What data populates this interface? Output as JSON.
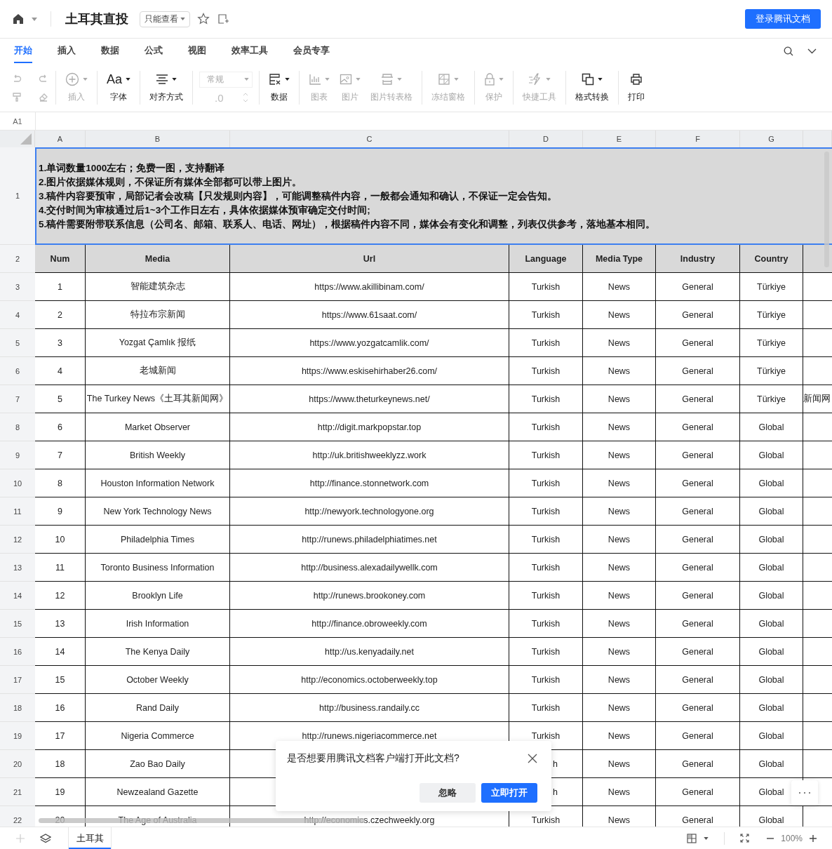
{
  "topbar": {
    "title": "土耳其直投",
    "permission": "只能查看",
    "login_button": "登录腾讯文档"
  },
  "menu_tabs": [
    {
      "label": "开始",
      "selected": true
    },
    {
      "label": "插入",
      "selected": false
    },
    {
      "label": "数据",
      "selected": false
    },
    {
      "label": "公式",
      "selected": false
    },
    {
      "label": "视图",
      "selected": false
    },
    {
      "label": "效率工具",
      "selected": false
    },
    {
      "label": "会员专享",
      "selected": false
    }
  ],
  "history_tools": [
    {
      "kind": "undo",
      "disabled": true
    },
    {
      "kind": "redo",
      "disabled": true
    },
    {
      "kind": "paint",
      "disabled": true
    },
    {
      "kind": "eraser",
      "disabled": true
    }
  ],
  "toolbar_groups": [
    {
      "items": [
        {
          "kind": "insert",
          "label": "插入",
          "disabled": true,
          "dropdown": true
        }
      ]
    },
    {
      "items": [
        {
          "kind": "font",
          "glyph": "Aa",
          "label": "字体",
          "disabled": false,
          "dropdown": true
        }
      ]
    },
    {
      "items": [
        {
          "kind": "align",
          "label": "对齐方式",
          "disabled": false,
          "dropdown": true
        }
      ]
    },
    {
      "kind": "number-format",
      "format": "常规",
      "decimal": ".0",
      "disabled": true
    },
    {
      "items": [
        {
          "kind": "data",
          "label": "数据",
          "disabled": false,
          "dropdown": true
        }
      ]
    },
    {
      "items": [
        {
          "kind": "chart",
          "label": "图表",
          "disabled": true,
          "dropdown": true
        },
        {
          "kind": "image",
          "label": "图片",
          "disabled": true,
          "dropdown": true
        },
        {
          "kind": "image-table",
          "label": "图片转表格",
          "disabled": true,
          "dropdown": true
        }
      ]
    },
    {
      "items": [
        {
          "kind": "freeze",
          "label": "冻结窗格",
          "disabled": true,
          "dropdown": true
        }
      ]
    },
    {
      "items": [
        {
          "kind": "protect",
          "label": "保护",
          "disabled": true,
          "dropdown": true
        }
      ]
    },
    {
      "items": [
        {
          "kind": "quick",
          "label": "快捷工具",
          "disabled": true,
          "dropdown": true
        }
      ]
    },
    {
      "items": [
        {
          "kind": "convert",
          "label": "格式转换",
          "disabled": false,
          "dropdown": true
        }
      ]
    },
    {
      "items": [
        {
          "kind": "print",
          "label": "打印",
          "disabled": false,
          "dropdown": false
        }
      ]
    }
  ],
  "cell_reference": "A1",
  "columns": [
    "A",
    "B",
    "C",
    "D",
    "E",
    "F",
    "G"
  ],
  "notice": {
    "row": "1",
    "lines": [
      "1.单词数量1000左右；免费一图，支持翻译",
      "2.图片依据媒体规则，不保证所有媒体全部都可以带上图片。",
      "3.稿件内容要预审，局部记者会改稿【只发规则内容】，可能调整稿件内容，一般都会通知和确认，不保证一定会告知。",
      "4.交付时间为审核通过后1~3个工作日左右，具体依据媒体预审确定交付时间;",
      "5.稿件需要附带联系信息（公司名、邮箱、联系人、电话、网址），根据稿件内容不同，媒体会有变化和调整，列表仅供参考，落地基本相同。"
    ]
  },
  "header": {
    "row": "2",
    "cells": [
      "Num",
      "Media",
      "Url",
      "Language",
      "Media Type",
      "Industry",
      "Country"
    ]
  },
  "rows": [
    {
      "row": "3",
      "num": "1",
      "media": "智能建筑杂志",
      "url": "https://www.akillibinam.com/",
      "language": "Turkish",
      "media_type": "News",
      "industry": "General",
      "country": "Türkiye"
    },
    {
      "row": "4",
      "num": "2",
      "media": "特拉布宗新闻",
      "url": "https://www.61saat.com/",
      "language": "Turkish",
      "media_type": "News",
      "industry": "General",
      "country": "Türkiye"
    },
    {
      "row": "5",
      "num": "3",
      "media": "Yozgat Çamlık 报纸",
      "url": "https://www.yozgatcamlik.com/",
      "language": "Turkish",
      "media_type": "News",
      "industry": "General",
      "country": "Türkiye"
    },
    {
      "row": "6",
      "num": "4",
      "media": "老城新闻",
      "url": "https://www.eskisehirhaber26.com/",
      "language": "Turkish",
      "media_type": "News",
      "industry": "General",
      "country": "Türkiye"
    },
    {
      "row": "7",
      "num": "5",
      "media": "The Turkey News《土耳其新闻网》",
      "url": "https://www.theturkeynews.net/",
      "language": "Turkish",
      "media_type": "News",
      "industry": "General",
      "country": "Türkiye",
      "column_8": "新闻网"
    },
    {
      "row": "8",
      "num": "6",
      "media": "Market Observer",
      "url": "http://digit.markpopstar.top",
      "language": "Turkish",
      "media_type": "News",
      "industry": "General",
      "country": "Global"
    },
    {
      "row": "9",
      "num": "7",
      "media": "British Weekly",
      "url": "http://uk.britishweeklyzz.work",
      "language": "Turkish",
      "media_type": "News",
      "industry": "General",
      "country": "Global"
    },
    {
      "row": "10",
      "num": "8",
      "media": "Houston Information Network",
      "url": "http://finance.stonnetwork.com",
      "language": "Turkish",
      "media_type": "News",
      "industry": "General",
      "country": "Global"
    },
    {
      "row": "11",
      "num": "9",
      "media": "New York Technology News",
      "url": "http://newyork.technologyone.org",
      "language": "Turkish",
      "media_type": "News",
      "industry": "General",
      "country": "Global"
    },
    {
      "row": "12",
      "num": "10",
      "media": "Philadelphia Times",
      "url": "http://runews.philadelphiatimes.net",
      "language": "Turkish",
      "media_type": "News",
      "industry": "General",
      "country": "Global"
    },
    {
      "row": "13",
      "num": "11",
      "media": "Toronto Business Information",
      "url": "http://business.alexadailywellk.com",
      "language": "Turkish",
      "media_type": "News",
      "industry": "General",
      "country": "Global"
    },
    {
      "row": "14",
      "num": "12",
      "media": "Brooklyn Life",
      "url": "http://runews.brookoney.com",
      "language": "Turkish",
      "media_type": "News",
      "industry": "General",
      "country": "Global"
    },
    {
      "row": "15",
      "num": "13",
      "media": "Irish Information",
      "url": "http://finance.obroweekly.com",
      "language": "Turkish",
      "media_type": "News",
      "industry": "General",
      "country": "Global"
    },
    {
      "row": "16",
      "num": "14",
      "media": "The Kenya Daily",
      "url": "http://us.kenyadaily.net",
      "language": "Turkish",
      "media_type": "News",
      "industry": "General",
      "country": "Global"
    },
    {
      "row": "17",
      "num": "15",
      "media": "October Weekly",
      "url": "http://economics.octoberweekly.top",
      "language": "Turkish",
      "media_type": "News",
      "industry": "General",
      "country": "Global"
    },
    {
      "row": "18",
      "num": "16",
      "media": "Rand Daily",
      "url": "http://business.randaily.cc",
      "language": "Turkish",
      "media_type": "News",
      "industry": "General",
      "country": "Global"
    },
    {
      "row": "19",
      "num": "17",
      "media": "Nigeria Commerce",
      "url": "http://runews.nigeriacommerce.net",
      "language": "Turkish",
      "media_type": "News",
      "industry": "General",
      "country": "Global"
    },
    {
      "row": "20",
      "num": "18",
      "media": "Zao Bao Daily",
      "language": "h",
      "media_type": "News",
      "industry": "General",
      "country": "Global"
    },
    {
      "row": "21",
      "num": "19",
      "media": "Newzealand Gazette",
      "language": "h",
      "media_type": "News",
      "industry": "General",
      "country": "Global"
    },
    {
      "row": "22",
      "num": "20",
      "media": "The Age of Australia",
      "url": "http://economics.czechweekly.org",
      "language": "Turkish",
      "media_type": "News",
      "industry": "General",
      "country": "Global"
    }
  ],
  "dialog": {
    "message": "是否想要用腾讯文档客户端打开此文档?",
    "buttons": [
      {
        "label": "忽略",
        "kind": "secondary"
      },
      {
        "label": "立即打开",
        "kind": "primary"
      }
    ]
  },
  "sheet_tabs": [
    {
      "label": "土耳其",
      "selected": true
    }
  ],
  "zoom": "100%"
}
